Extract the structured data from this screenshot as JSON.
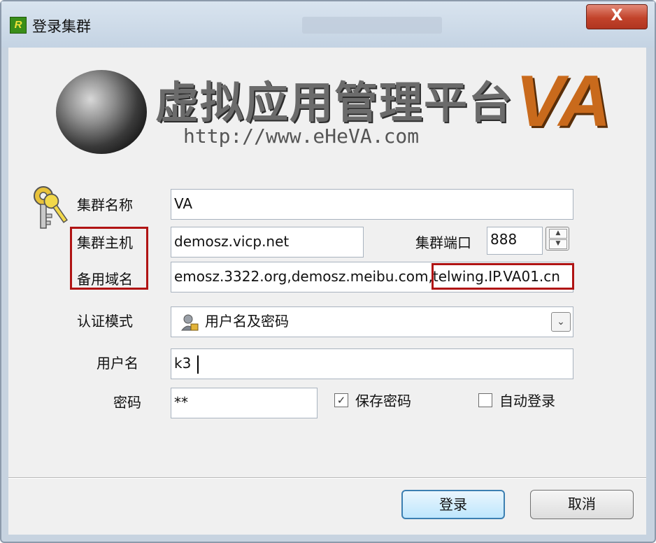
{
  "window": {
    "title": "登录集群",
    "close_symbol": "X",
    "app_icon_letter": "R"
  },
  "banner": {
    "title": "虚拟应用管理平台",
    "brand": "VA",
    "url": "http://www.eHeVA.com"
  },
  "form": {
    "cluster_name": {
      "label": "集群名称",
      "value": "VA"
    },
    "cluster_host": {
      "label": "集群主机",
      "value": "demosz.vicp.net"
    },
    "cluster_port": {
      "label": "集群端口",
      "value": "888"
    },
    "backup_domain": {
      "label": "备用域名",
      "value": "emosz.3322.org,demosz.meibu.com,telwing.IP.VA01.cn"
    },
    "auth_mode": {
      "label": "认证模式",
      "value": "用户名及密码",
      "icon": "user-lock-icon"
    },
    "username": {
      "label": "用户名",
      "value": "k3"
    },
    "password": {
      "label": "密码",
      "value": "**"
    },
    "save_password": {
      "label": "保存密码",
      "checked": true
    },
    "auto_login": {
      "label": "自动登录",
      "checked": false
    }
  },
  "buttons": {
    "login": "登录",
    "cancel": "取消"
  },
  "highlight_color": "#b01414"
}
